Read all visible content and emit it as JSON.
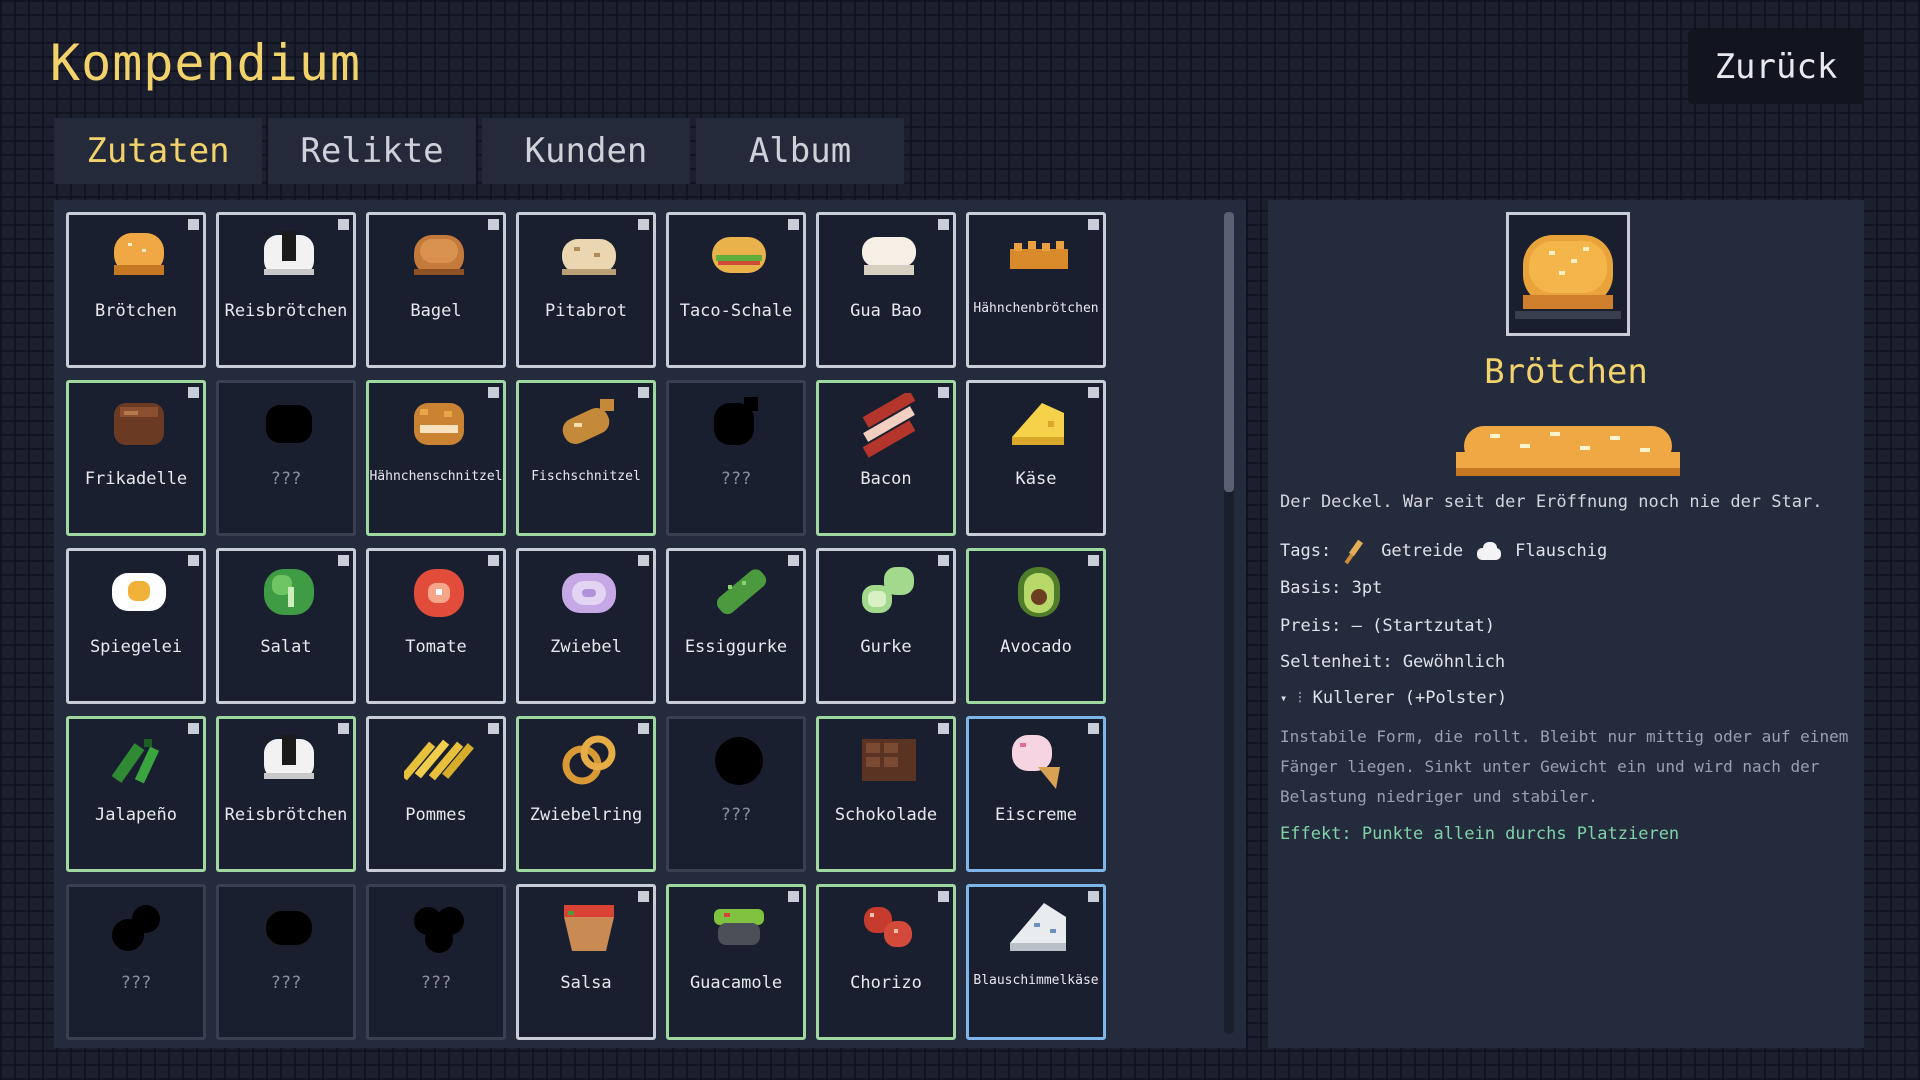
{
  "header": {
    "title": "Kompendium",
    "back_label": "Zurück"
  },
  "tabs": [
    {
      "label": "Zutaten",
      "active": true
    },
    {
      "label": "Relikte",
      "active": false
    },
    {
      "label": "Kunden",
      "active": false
    },
    {
      "label": "Album",
      "active": false
    }
  ],
  "items": [
    {
      "name": "Brötchen",
      "sprite": "bun-icon",
      "border": "white"
    },
    {
      "name": "Reisbrötchen",
      "sprite": "rice-bun-icon",
      "border": "white"
    },
    {
      "name": "Bagel",
      "sprite": "bagel-icon",
      "border": "white"
    },
    {
      "name": "Pitabrot",
      "sprite": "pita-icon",
      "border": "white"
    },
    {
      "name": "Taco-Schale",
      "sprite": "taco-icon",
      "border": "white"
    },
    {
      "name": "Gua Bao",
      "sprite": "gua-bao-icon",
      "border": "white"
    },
    {
      "name": "Hähnchenbrötchen",
      "sprite": "chicken-bun-icon",
      "border": "white"
    },
    {
      "name": "Frikadelle",
      "sprite": "patty-icon",
      "border": "green"
    },
    {
      "name": "???",
      "sprite": "unknown-icon",
      "border": "unknown"
    },
    {
      "name": "Hähnchenschnitzel",
      "sprite": "chicken-schnitzel-icon",
      "border": "green"
    },
    {
      "name": "Fischschnitzel",
      "sprite": "fish-schnitzel-icon",
      "border": "green"
    },
    {
      "name": "???",
      "sprite": "unknown-icon",
      "border": "unknown"
    },
    {
      "name": "Bacon",
      "sprite": "bacon-icon",
      "border": "green"
    },
    {
      "name": "Käse",
      "sprite": "cheese-icon",
      "border": "white"
    },
    {
      "name": "Spiegelei",
      "sprite": "fried-egg-icon",
      "border": "white"
    },
    {
      "name": "Salat",
      "sprite": "lettuce-icon",
      "border": "white"
    },
    {
      "name": "Tomate",
      "sprite": "tomato-icon",
      "border": "white"
    },
    {
      "name": "Zwiebel",
      "sprite": "onion-icon",
      "border": "white"
    },
    {
      "name": "Essiggurke",
      "sprite": "pickle-icon",
      "border": "white"
    },
    {
      "name": "Gurke",
      "sprite": "cucumber-icon",
      "border": "white"
    },
    {
      "name": "Avocado",
      "sprite": "avocado-icon",
      "border": "green"
    },
    {
      "name": "Jalapeño",
      "sprite": "jalapeno-icon",
      "border": "green"
    },
    {
      "name": "Reisbrötchen",
      "sprite": "rice-bun-icon",
      "border": "green"
    },
    {
      "name": "Pommes",
      "sprite": "fries-icon",
      "border": "white"
    },
    {
      "name": "Zwiebelring",
      "sprite": "onion-ring-icon",
      "border": "green"
    },
    {
      "name": "???",
      "sprite": "unknown-icon",
      "border": "unknown"
    },
    {
      "name": "Schokolade",
      "sprite": "chocolate-icon",
      "border": "green"
    },
    {
      "name": "Eiscreme",
      "sprite": "ice-cream-icon",
      "border": "blue"
    },
    {
      "name": "???",
      "sprite": "unknown-icon",
      "border": "unknown"
    },
    {
      "name": "???",
      "sprite": "unknown-icon",
      "border": "unknown"
    },
    {
      "name": "???",
      "sprite": "unknown-icon",
      "border": "unknown"
    },
    {
      "name": "Salsa",
      "sprite": "salsa-icon",
      "border": "white"
    },
    {
      "name": "Guacamole",
      "sprite": "guacamole-icon",
      "border": "green"
    },
    {
      "name": "Chorizo",
      "sprite": "chorizo-icon",
      "border": "green"
    },
    {
      "name": "Blauschimmelkäse",
      "sprite": "blue-cheese-icon",
      "border": "blue"
    }
  ],
  "detail": {
    "name": "Brötchen",
    "description": "Der Deckel. War seit der Eröffnung noch nie der Star.",
    "tags_label": "Tags:",
    "tags": [
      {
        "label": "Getreide",
        "icon": "wheat-icon"
      },
      {
        "label": "Flauschig",
        "icon": "cloud-icon"
      }
    ],
    "basis": "Basis: 3pt",
    "price": "Preis: — (Startzutat)",
    "rarity": "Seltenheit: Gewöhnlich",
    "trait": "Kullerer (+Polster)",
    "trait_detail": "Instabile Form, die rollt. Bleibt nur mittig oder auf einem Fänger liegen. Sinkt unter Gewicht ein und wird nach der Belastung niedriger und stabiler.",
    "effect": "Effekt: Punkte allein durchs Platzieren"
  },
  "colors": {
    "accent": "#f2d36b",
    "effect": "#7fd3a6",
    "border_green": "#9fd8a0",
    "border_blue": "#7fb6ea"
  }
}
